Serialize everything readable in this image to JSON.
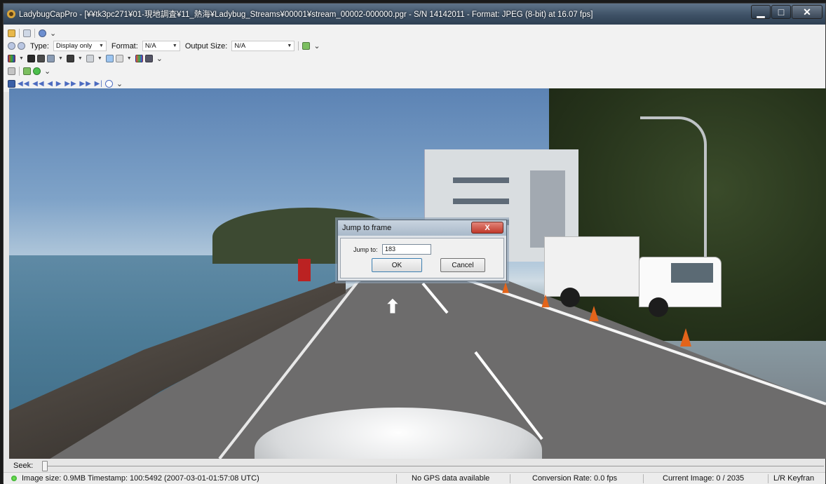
{
  "window": {
    "title": "LadybugCapPro - [¥¥tk3pc271¥01-現地調査¥11_熱海¥Ladybug_Streams¥00001¥stream_00002-000000.pgr - S/N 14142011 - Format: JPEG (8-bit) at 16.07 fps]",
    "min_glyph": "▁",
    "max_glyph": "□",
    "close_glyph": "✕"
  },
  "toolbar": {
    "type_label": "Type:",
    "type_value": "Display only",
    "format_label": "Format:",
    "format_value": "N/A",
    "output_size_label": "Output Size:",
    "output_size_value": "N/A",
    "playback_glyphs": "◀◀ ◀◀ ◀ ▶ ▶▶ ▶▶ ▶|"
  },
  "dialog": {
    "title": "Jump to frame",
    "close_glyph": "X",
    "jump_label": "Jump to:",
    "jump_value": "183",
    "ok_label": "OK",
    "cancel_label": "Cancel"
  },
  "seek": {
    "label": "Seek:"
  },
  "status": {
    "image_info": "Image size: 0.9MB Timestamp: 100:5492 (2007-03-01-01:57:08 UTC)",
    "gps": "No GPS data available",
    "conversion_rate": "Conversion Rate: 0.0 fps",
    "current_image": "Current Image: 0 / 2035",
    "keyframe": "L/R Keyfran"
  },
  "colors": {
    "titlebar": "#3e5166",
    "dialog_close": "#c0392b",
    "status_led": "#1d9b1d"
  }
}
